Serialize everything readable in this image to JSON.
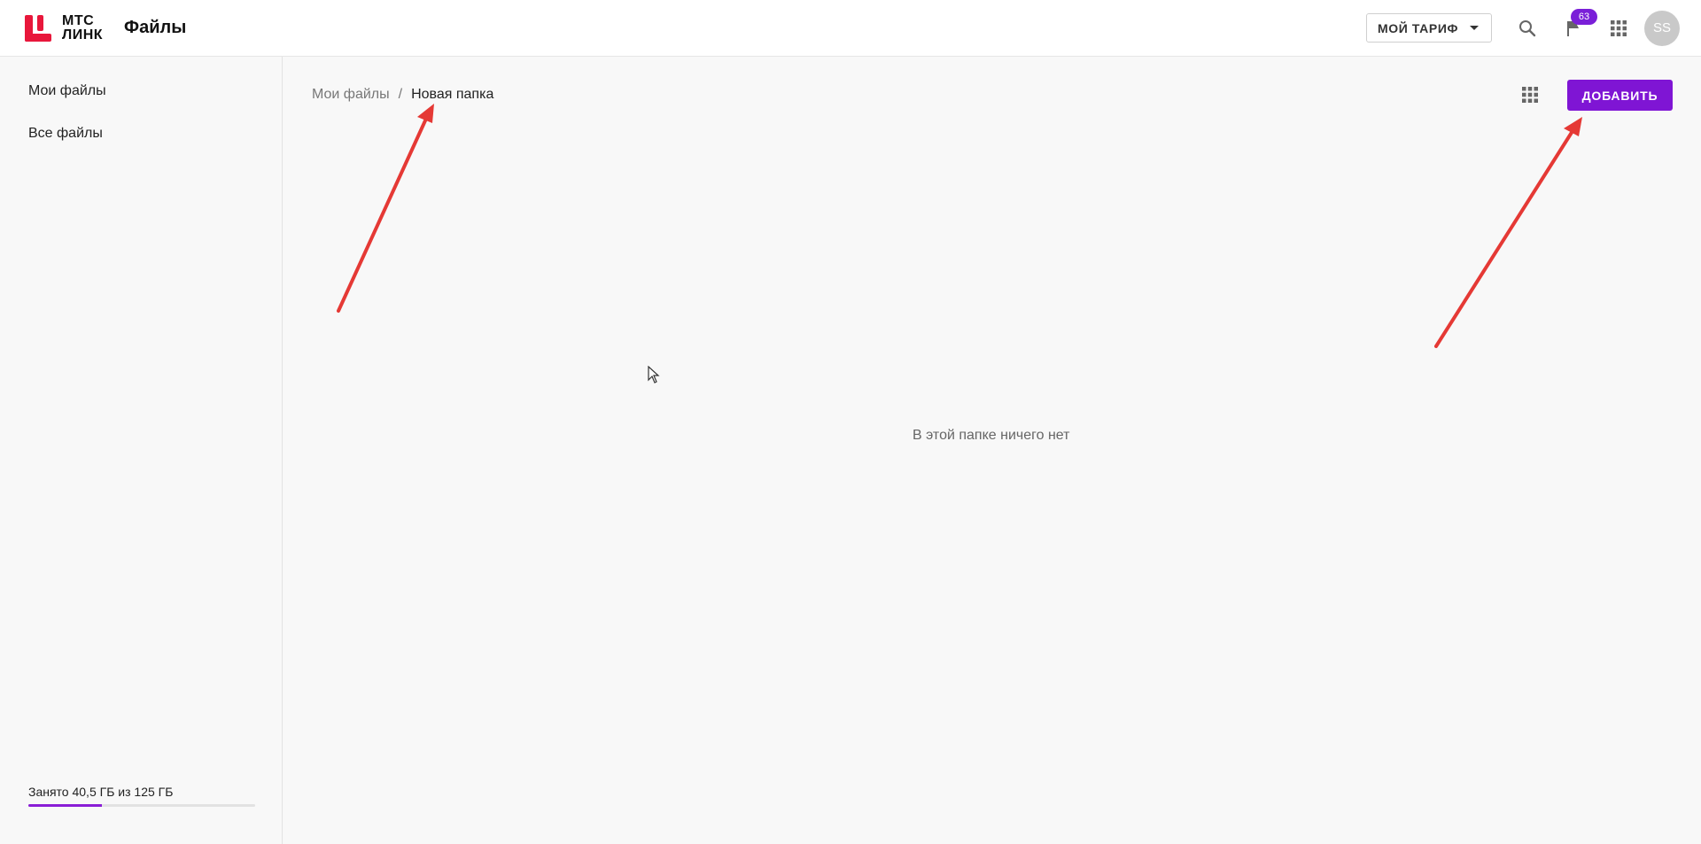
{
  "header": {
    "logo_line1": "МТС",
    "logo_line2": "ЛИНК",
    "app_title": "Файлы",
    "tariff_label": "МОЙ ТАРИФ",
    "notification_count": "63",
    "avatar_initials": "SS",
    "brand_color": "#e8173b",
    "badge_color": "#7a1fd8"
  },
  "sidebar": {
    "items": [
      {
        "label": "Мои файлы"
      },
      {
        "label": "Все файлы"
      }
    ],
    "storage": {
      "label": "Занято 40,5 ГБ из 125 ГБ",
      "used_fraction": 0.324,
      "color": "#8a1ed6"
    }
  },
  "main": {
    "breadcrumb": {
      "parent": "Мои файлы",
      "separator": "/",
      "current": "Новая папка"
    },
    "add_button": "ДОБАВИТЬ",
    "add_button_color": "#7f15d4",
    "empty_message": "В этой папке ничего нет"
  },
  "icons": {
    "search": "search-icon",
    "notifications": "flag-icon",
    "apps": "apps-grid-icon",
    "view_toggle": "grid-view-icon"
  },
  "annotation_color": "#e53935"
}
